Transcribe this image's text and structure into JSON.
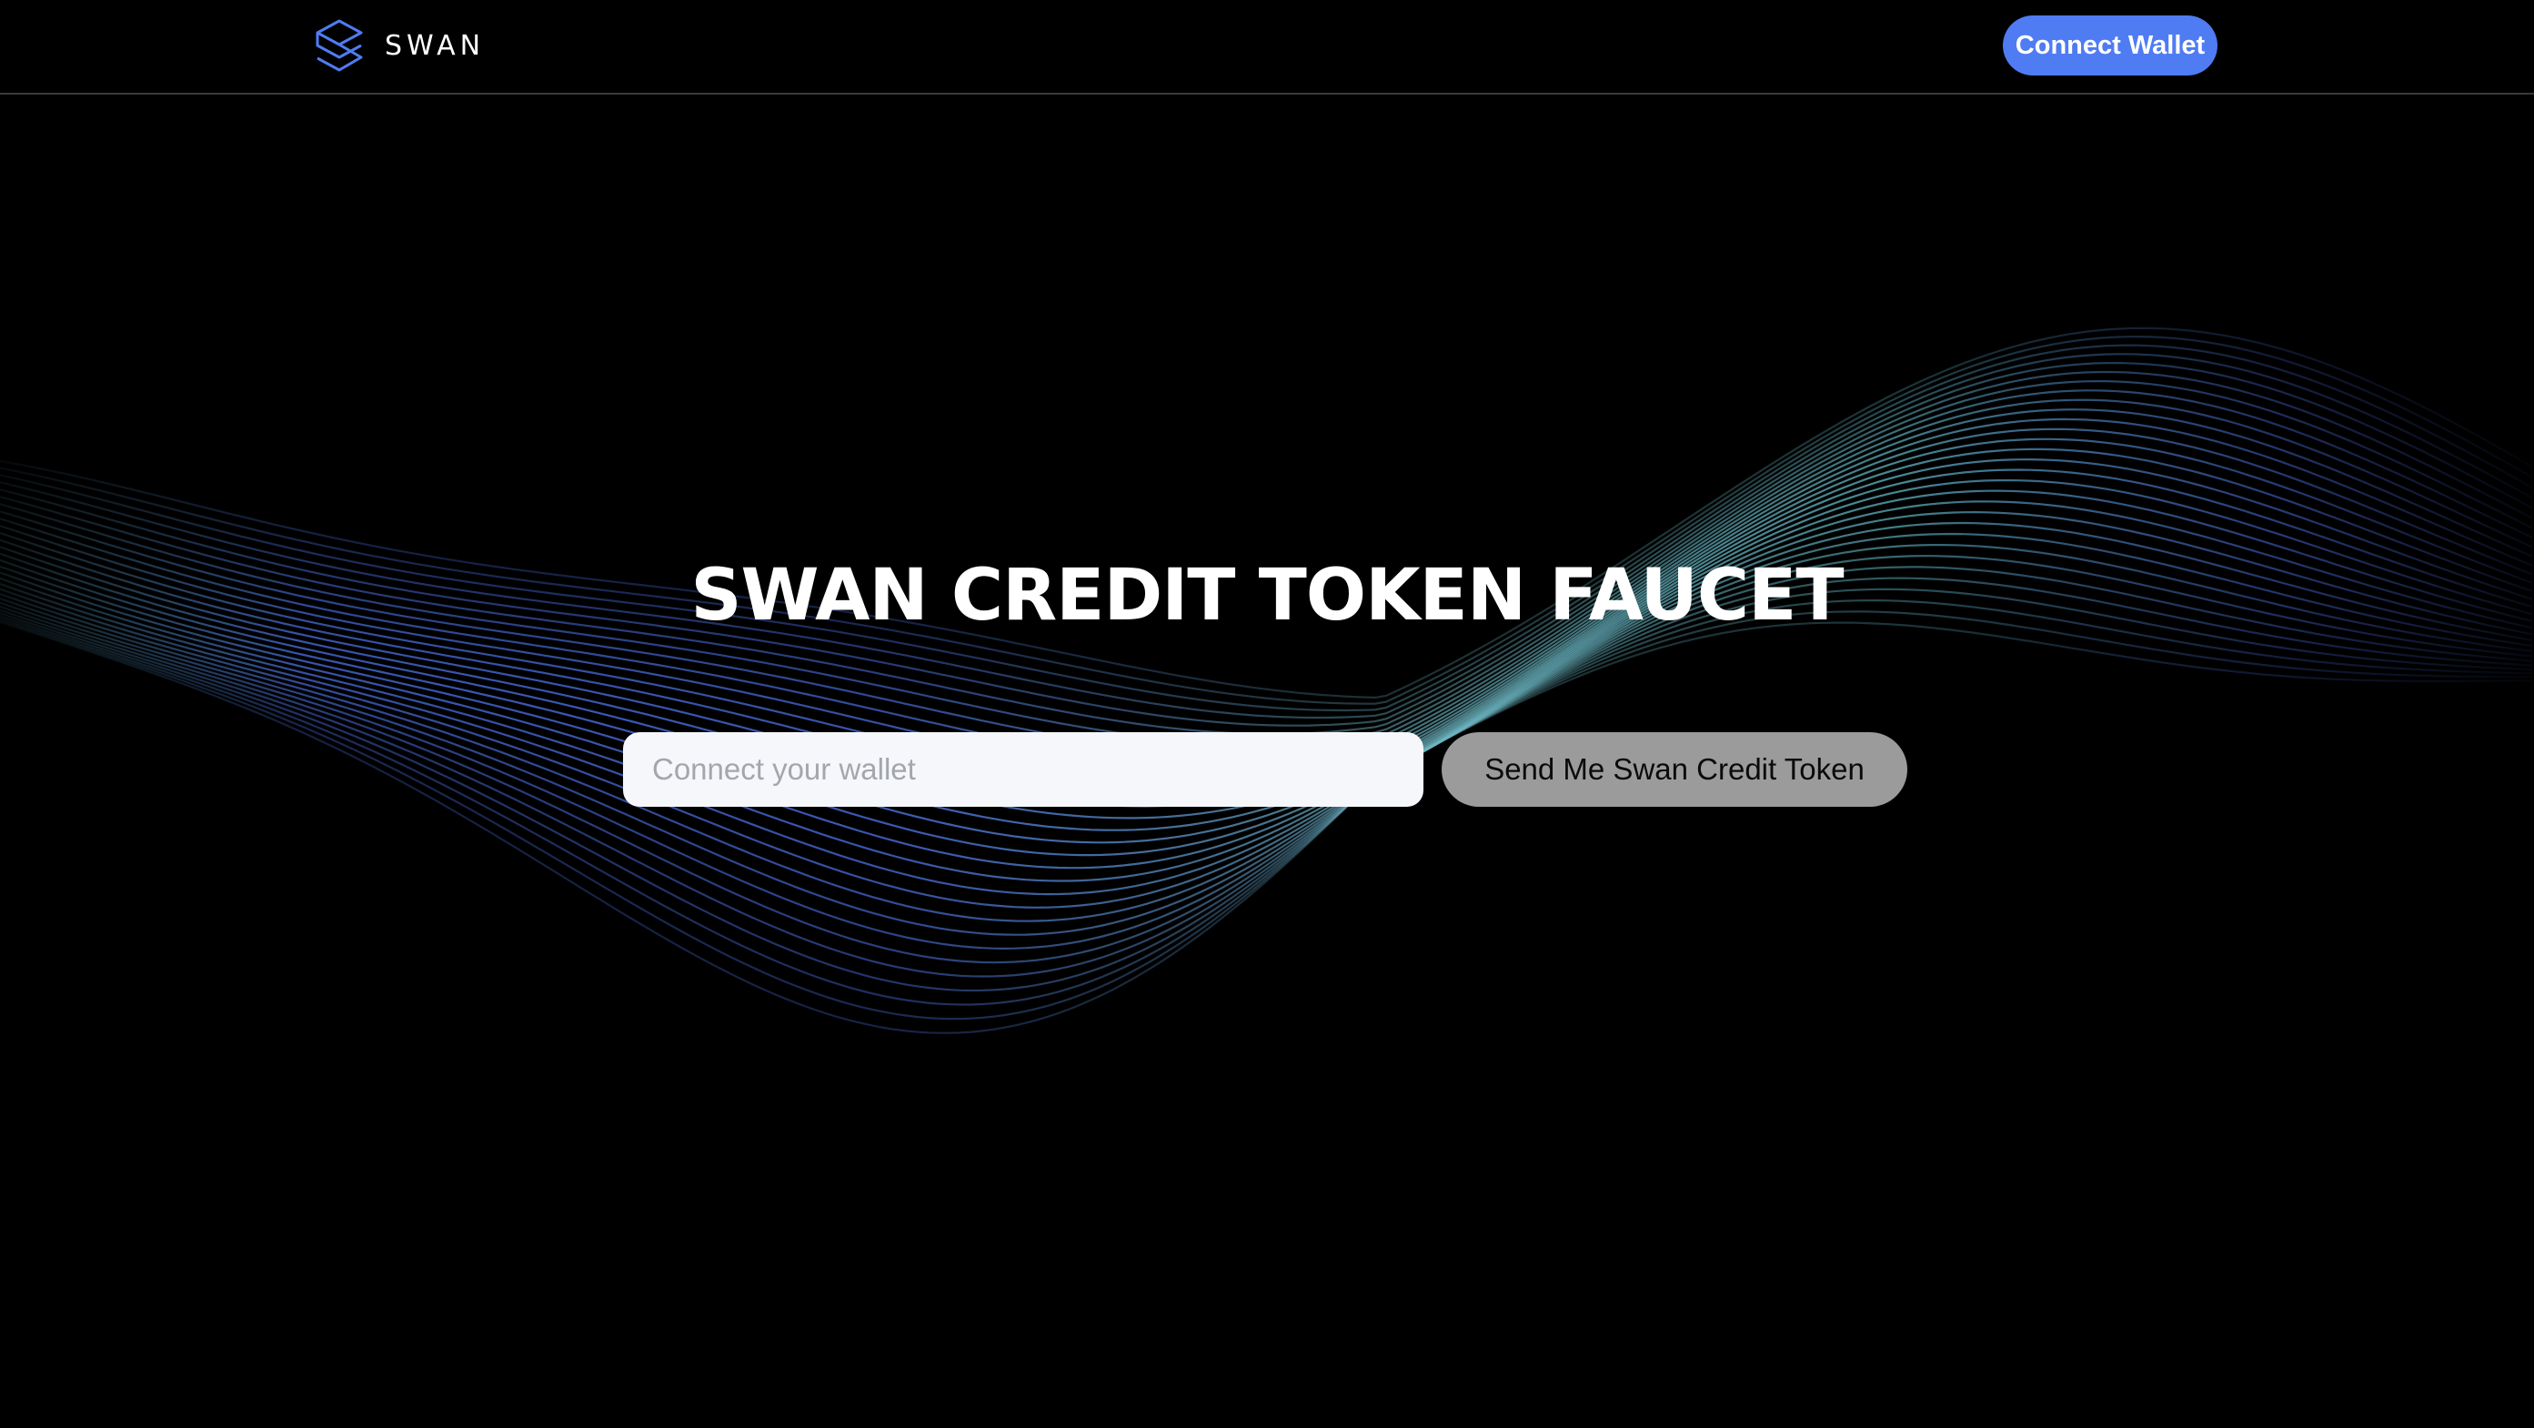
{
  "header": {
    "brand_name": "SWAN",
    "logo_icon": "swan-logo-icon",
    "connect_label": "Connect Wallet"
  },
  "hero": {
    "title": "SWAN CREDIT TOKEN FAUCET",
    "input_placeholder": "Connect your wallet",
    "input_value": "",
    "send_label": "Send Me Swan Credit Token"
  },
  "colors": {
    "background": "#000000",
    "accent_blue": "#4f7cf2",
    "wave_teal": "#5fb3c0",
    "wave_blue": "#4a6fe0",
    "send_button_bg": "#9b9b9b",
    "input_bg": "#f6f7fa"
  }
}
